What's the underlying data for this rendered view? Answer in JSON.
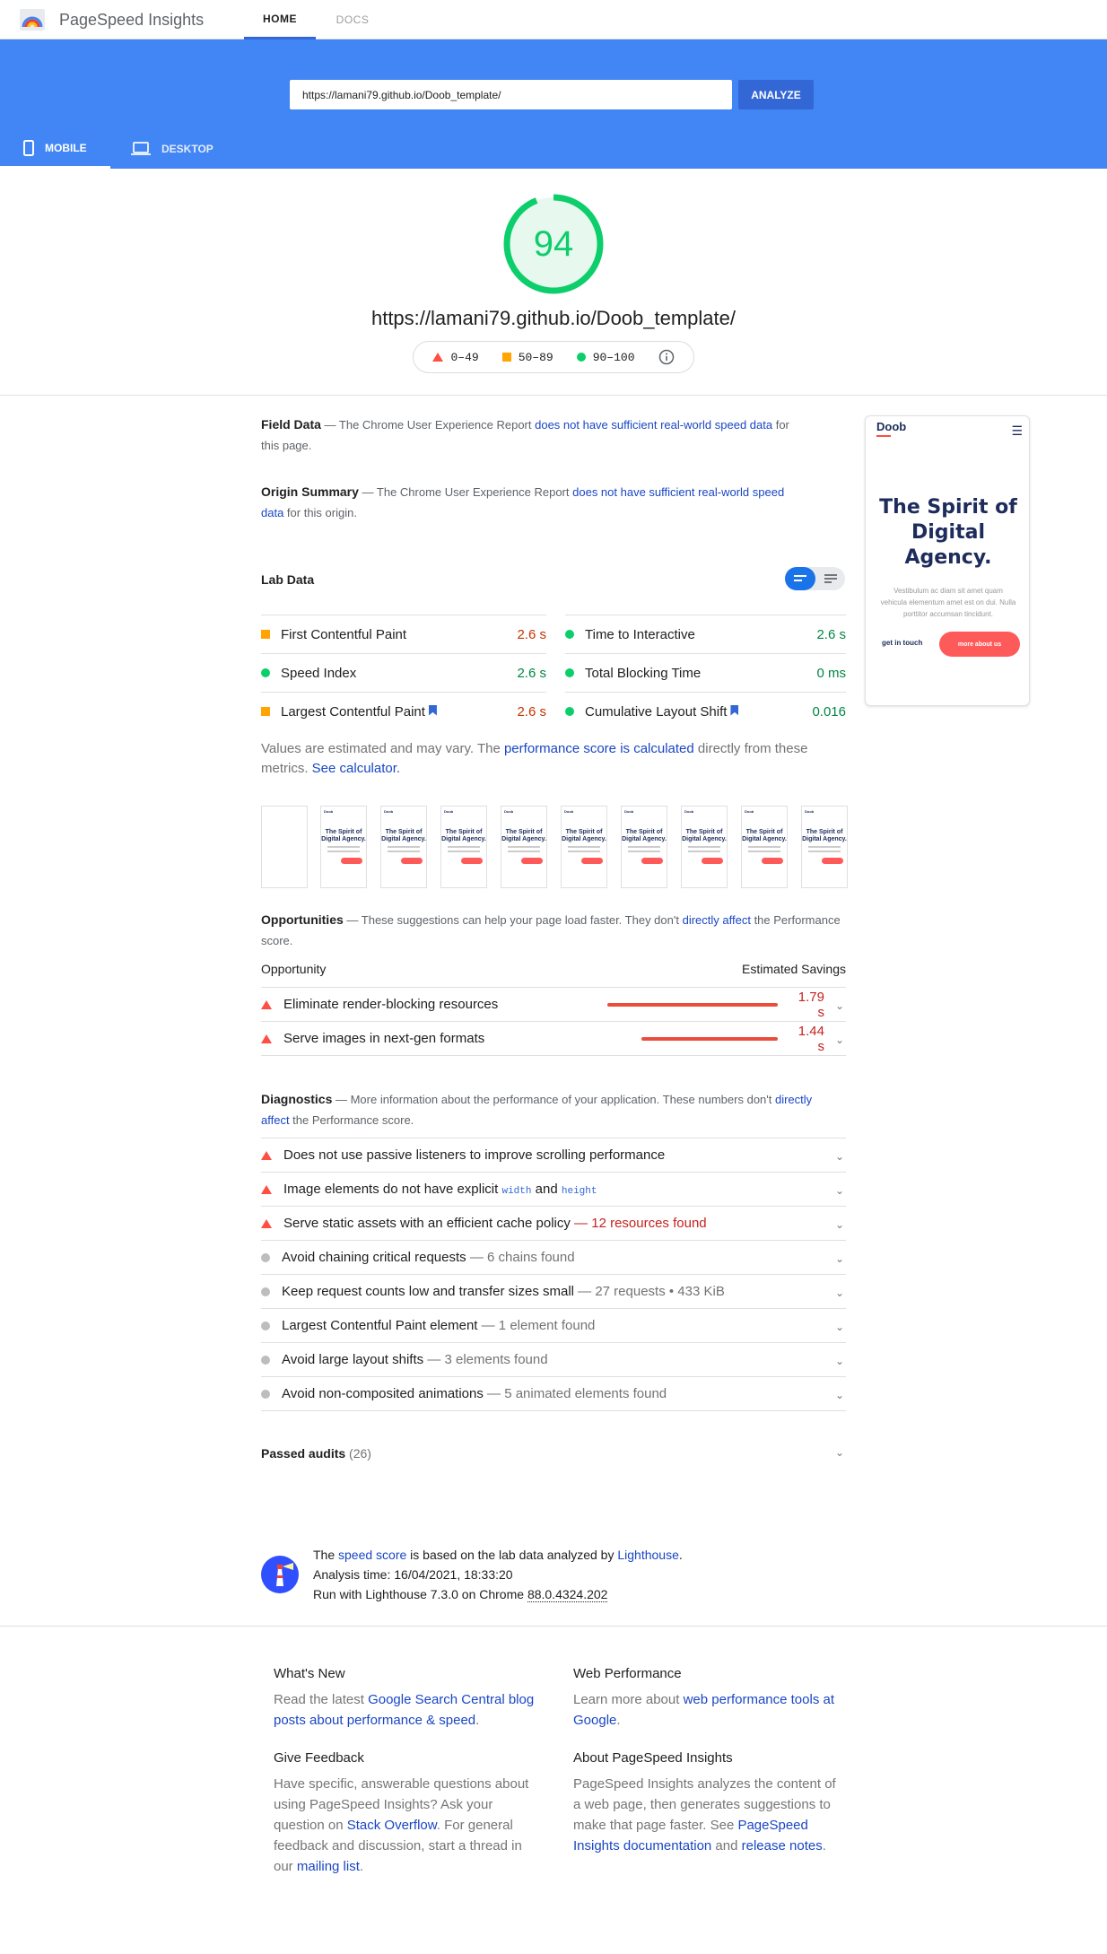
{
  "app": {
    "title": "PageSpeed Insights"
  },
  "nav": {
    "home": "HOME",
    "docs": "DOCS"
  },
  "search": {
    "value": "https://lamani79.github.io/Doob_template/",
    "analyze": "ANALYZE"
  },
  "device_tabs": {
    "mobile": "MOBILE",
    "desktop": "DESKTOP"
  },
  "score": {
    "value": "94",
    "url": "https://lamani79.github.io/Doob_template/",
    "color": "#0cce6b"
  },
  "legend": {
    "bad": "0–49",
    "avg": "50–89",
    "good": "90–100"
  },
  "field_data": {
    "title": "Field Data",
    "pre": " — The Chrome User Experience Report ",
    "link": "does not have sufficient real-world speed data",
    "post": " for this page."
  },
  "origin_summary": {
    "title": "Origin Summary",
    "pre": " — The Chrome User Experience Report ",
    "link": "does not have sufficient real-world speed data",
    "post": " for this origin."
  },
  "lab_data": {
    "title": "Lab Data",
    "metrics": [
      {
        "label": "First Contentful Paint",
        "value": "2.6 s",
        "status": "average"
      },
      {
        "label": "Time to Interactive",
        "value": "2.6 s",
        "status": "good"
      },
      {
        "label": "Speed Index",
        "value": "2.6 s",
        "status": "good"
      },
      {
        "label": "Total Blocking Time",
        "value": "0 ms",
        "status": "good"
      },
      {
        "label": "Largest Contentful Paint",
        "value": "2.6 s",
        "status": "average"
      },
      {
        "label": "Cumulative Layout Shift",
        "value": "0.016",
        "status": "good"
      }
    ],
    "note_pre": "Values are estimated and may vary. The ",
    "note_link": "performance score is calculated",
    "note_mid": " directly from these metrics. ",
    "note_link2": "See calculator."
  },
  "filmstrip": {
    "header": "Doob",
    "title": "The Spirit of Digital Agency."
  },
  "opportunities": {
    "title": "Opportunities",
    "pre": " — These suggestions can help your page load faster. They don't ",
    "link": "directly affect",
    "post": " the Performance score.",
    "col_left": "Opportunity",
    "col_right": "Estimated Savings",
    "items": [
      {
        "label": "Eliminate render-blocking resources",
        "savings": "1.79 s",
        "fraction": 1.0
      },
      {
        "label": "Serve images in next-gen formats",
        "savings": "1.44 s",
        "fraction": 0.8
      }
    ]
  },
  "diagnostics": {
    "title": "Diagnostics",
    "pre": " — More information about the performance of your application. These numbers don't ",
    "link": "directly affect",
    "post": " the Performance score.",
    "items": [
      {
        "label": "Does not use passive listeners to improve scrolling performance",
        "detail": ""
      },
      {
        "label": "Image elements do not have explicit ",
        "code1": "width",
        "and": " and ",
        "code2": "height"
      },
      {
        "label": "Serve static assets with an efficient cache policy",
        "detail": " — 12 resources found"
      },
      {
        "label": "Avoid chaining critical requests",
        "detail": " — 6 chains found"
      },
      {
        "label": "Keep request counts low and transfer sizes small",
        "detail": " — 27 requests • 433 KiB"
      },
      {
        "label": "Largest Contentful Paint element",
        "detail": " — 1 element found"
      },
      {
        "label": "Avoid large layout shifts",
        "detail": " — 3 elements found"
      },
      {
        "label": "Avoid non-composited animations",
        "detail": " — 5 animated elements found"
      }
    ]
  },
  "passed": {
    "title": "Passed audits",
    "count": "(26)"
  },
  "preview": {
    "logo": "Doob",
    "title": "The Spirit of Digital Agency.",
    "text": "Vestibulum ac diam sit amet quam vehicula elementum amet est on dui. Nulla porttitor accumsan tincidunt.",
    "link": "get in touch",
    "button": "more about us"
  },
  "lighthouse": {
    "pre": "The ",
    "link1": "speed score",
    "mid": " is based on the lab data analyzed by ",
    "link2": "Lighthouse",
    "end": ".",
    "time": "Analysis time: 16/04/2021, 18:33:20",
    "run_pre": "Run with Lighthouse 7.3.0 on Chrome ",
    "chrome": "88.0.4324.202"
  },
  "footer": {
    "whats_new": {
      "title": "What's New",
      "pre": "Read the latest ",
      "link": "Google Search Central blog posts about performance & speed",
      "post": "."
    },
    "web_perf": {
      "title": "Web Performance",
      "pre": "Learn more about ",
      "link": "web performance tools at Google",
      "post": "."
    },
    "feedback": {
      "title": "Give Feedback",
      "pre": "Have specific, answerable questions about using PageSpeed Insights? Ask your question on ",
      "link1": "Stack Overflow",
      "mid": ". For general feedback and discussion, start a thread in our ",
      "link2": "mailing list",
      "post": "."
    },
    "about": {
      "title": "About PageSpeed Insights",
      "pre": "PageSpeed Insights analyzes the content of a web page, then generates suggestions to make that page faster. See ",
      "link1": "PageSpeed Insights documentation",
      "mid": " and ",
      "link2": "release notes",
      "post": "."
    }
  }
}
